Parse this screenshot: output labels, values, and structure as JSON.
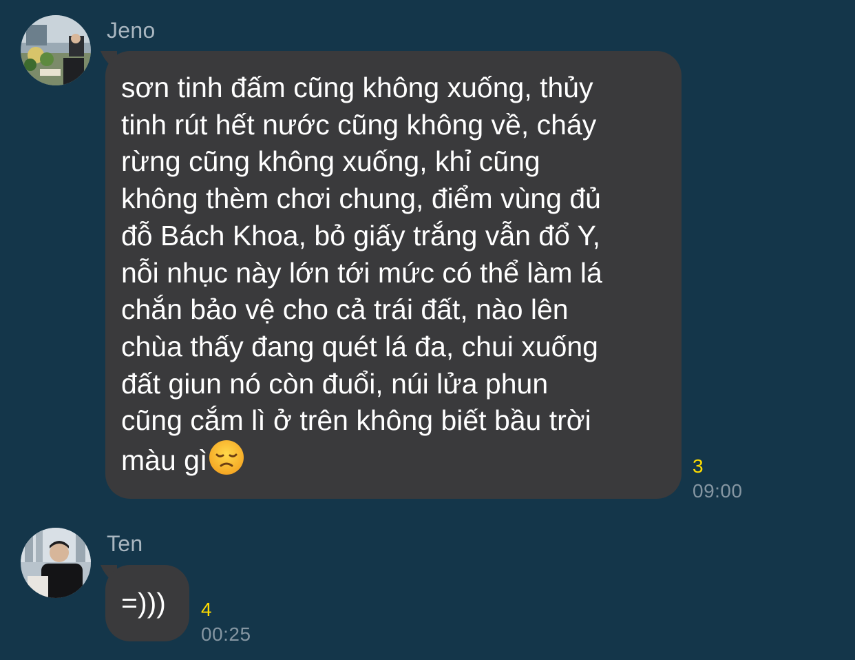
{
  "messages": [
    {
      "sender": "Jeno",
      "avatar_icon": "avatar-photo-icon",
      "text": "sơn tinh đấm cũng không xuống, thủy\ntinh rút hết nước cũng không về, cháy\nrừng cũng không xuống, khỉ cũng\nkhông thèm chơi chung, điểm vùng đủ\nđỗ Bách Khoa, bỏ giấy trắng vẫn đổ Y,\nnỗi nhục này lớn tới mức có thể làm lá\nchắn bảo vệ cho cả trái đất, nào lên\nchùa thấy đang quét lá đa, chui xuống\nđất giun nó còn đuổi, núi lửa phun\ncũng cắm lì ở trên không biết bầu trời\nmàu gì",
      "emoji": "disappointed-face-emoji",
      "unread": "3",
      "time": "09:00"
    },
    {
      "sender": "Ten",
      "avatar_icon": "avatar-photo-icon",
      "text": "=)))",
      "unread": "4",
      "time": "00:25"
    }
  ],
  "colors": {
    "background": "#14364a",
    "bubble": "#3a3a3c",
    "unread": "#ffdd00",
    "time": "#8596a2",
    "sender": "#a9b6c0"
  }
}
